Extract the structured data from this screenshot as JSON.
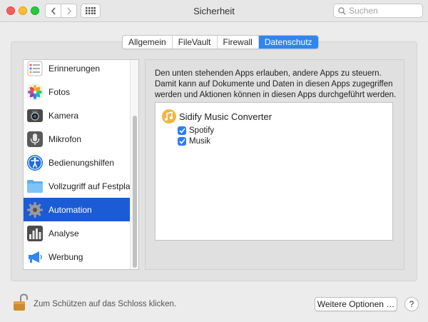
{
  "window": {
    "title": "Sicherheit"
  },
  "search": {
    "placeholder": "Suchen",
    "value": ""
  },
  "tabs": [
    {
      "label": "Allgemein",
      "active": false
    },
    {
      "label": "FileVault",
      "active": false
    },
    {
      "label": "Firewall",
      "active": false
    },
    {
      "label": "Datenschutz",
      "active": true
    }
  ],
  "sidebar": {
    "items": [
      {
        "label": "Erinnerungen",
        "icon": "reminders-icon",
        "selected": false
      },
      {
        "label": "Fotos",
        "icon": "photos-icon",
        "selected": false
      },
      {
        "label": "Kamera",
        "icon": "camera-icon",
        "selected": false
      },
      {
        "label": "Mikrofon",
        "icon": "microphone-icon",
        "selected": false
      },
      {
        "label": "Bedienungshilfen",
        "icon": "accessibility-icon",
        "selected": false
      },
      {
        "label": "Vollzugriff auf Festpla…",
        "icon": "folder-icon",
        "selected": false
      },
      {
        "label": "Automation",
        "icon": "gear-icon",
        "selected": true
      },
      {
        "label": "Analyse",
        "icon": "analytics-icon",
        "selected": false
      },
      {
        "label": "Werbung",
        "icon": "megaphone-icon",
        "selected": false
      }
    ]
  },
  "main": {
    "description": "Den unten stehenden Apps erlauben, andere Apps zu steuern. Damit kann auf Dokumente und Daten in diesen Apps zugegriffen werden und Aktionen können in diesen Apps durchgeführt werden.",
    "app": {
      "name": "Sidify Music Converter",
      "icon": "sidify-icon",
      "targets": [
        {
          "label": "Spotify",
          "checked": true
        },
        {
          "label": "Musik",
          "checked": true
        }
      ]
    }
  },
  "footer": {
    "lock_text": "Zum Schützen auf das Schloss klicken.",
    "more_options_label": "Weitere Optionen …",
    "help_label": "?"
  },
  "colors": {
    "accent": "#2f86f1",
    "selection": "#1c5bd6"
  }
}
